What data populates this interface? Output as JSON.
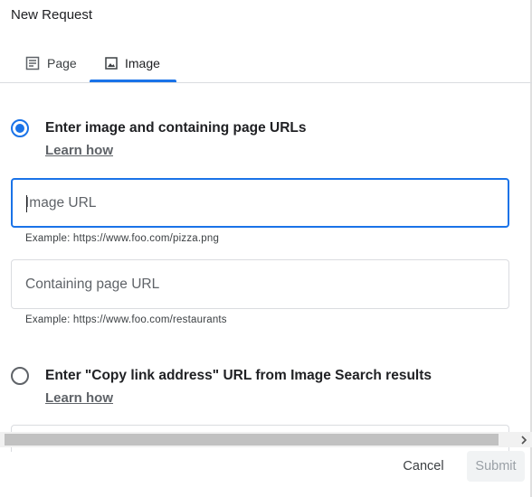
{
  "dialog": {
    "title": "New Request"
  },
  "tabs": [
    {
      "label": "Page",
      "icon": "document-icon"
    },
    {
      "label": "Image",
      "icon": "image-icon",
      "selected": true
    }
  ],
  "options": {
    "image_and_page": {
      "label": "Enter image and containing page URLs",
      "link": "Learn how",
      "selected": true
    },
    "copy_link": {
      "label": "Enter \"Copy link address\" URL from Image Search results",
      "link": "Learn how",
      "selected": false
    }
  },
  "fields": {
    "image_url": {
      "placeholder": "Image URL",
      "value": "",
      "hint": "Example: https://www.foo.com/pizza.png"
    },
    "page_url": {
      "placeholder": "Containing page URL",
      "value": "",
      "hint": "Example: https://www.foo.com/restaurants"
    }
  },
  "footer": {
    "cancel_label": "Cancel",
    "submit_label": "Submit"
  },
  "colors": {
    "accent": "#1a73e8",
    "text": "#202124",
    "muted": "#5f6368",
    "border": "#dadce0"
  }
}
